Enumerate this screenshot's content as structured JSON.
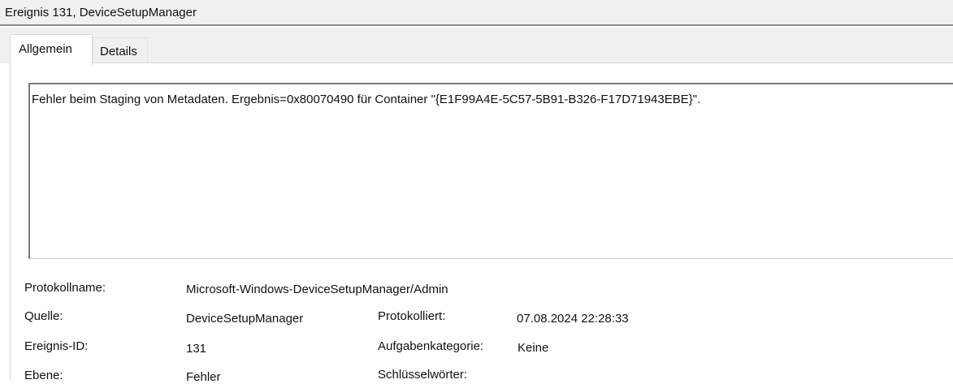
{
  "window": {
    "title": "Ereignis 131, DeviceSetupManager"
  },
  "tabs": [
    {
      "label": "Allgemein",
      "active": true
    },
    {
      "label": "Details",
      "active": false
    }
  ],
  "message": "Fehler beim Staging von Metadaten. Ergebnis=0x80070490 für Container \"{E1F99A4E-5C57-5B91-B326-F17D71943EBE}\".",
  "details": {
    "protokollname_label": "Protokollname:",
    "protokollname_value": "Microsoft-Windows-DeviceSetupManager/Admin",
    "quelle_label": "Quelle:",
    "quelle_value": "DeviceSetupManager",
    "protokolliert_label": "Protokolliert:",
    "protokolliert_value": "07.08.2024 22:28:33",
    "ereignis_id_label": "Ereignis-ID:",
    "ereignis_id_value": "131",
    "aufgabenkategorie_label": "Aufgabenkategorie:",
    "aufgabenkategorie_value": "Keine",
    "ebene_label": "Ebene:",
    "ebene_value": "Fehler",
    "schluesselwoerter_label": "Schlüsselwörter:"
  }
}
